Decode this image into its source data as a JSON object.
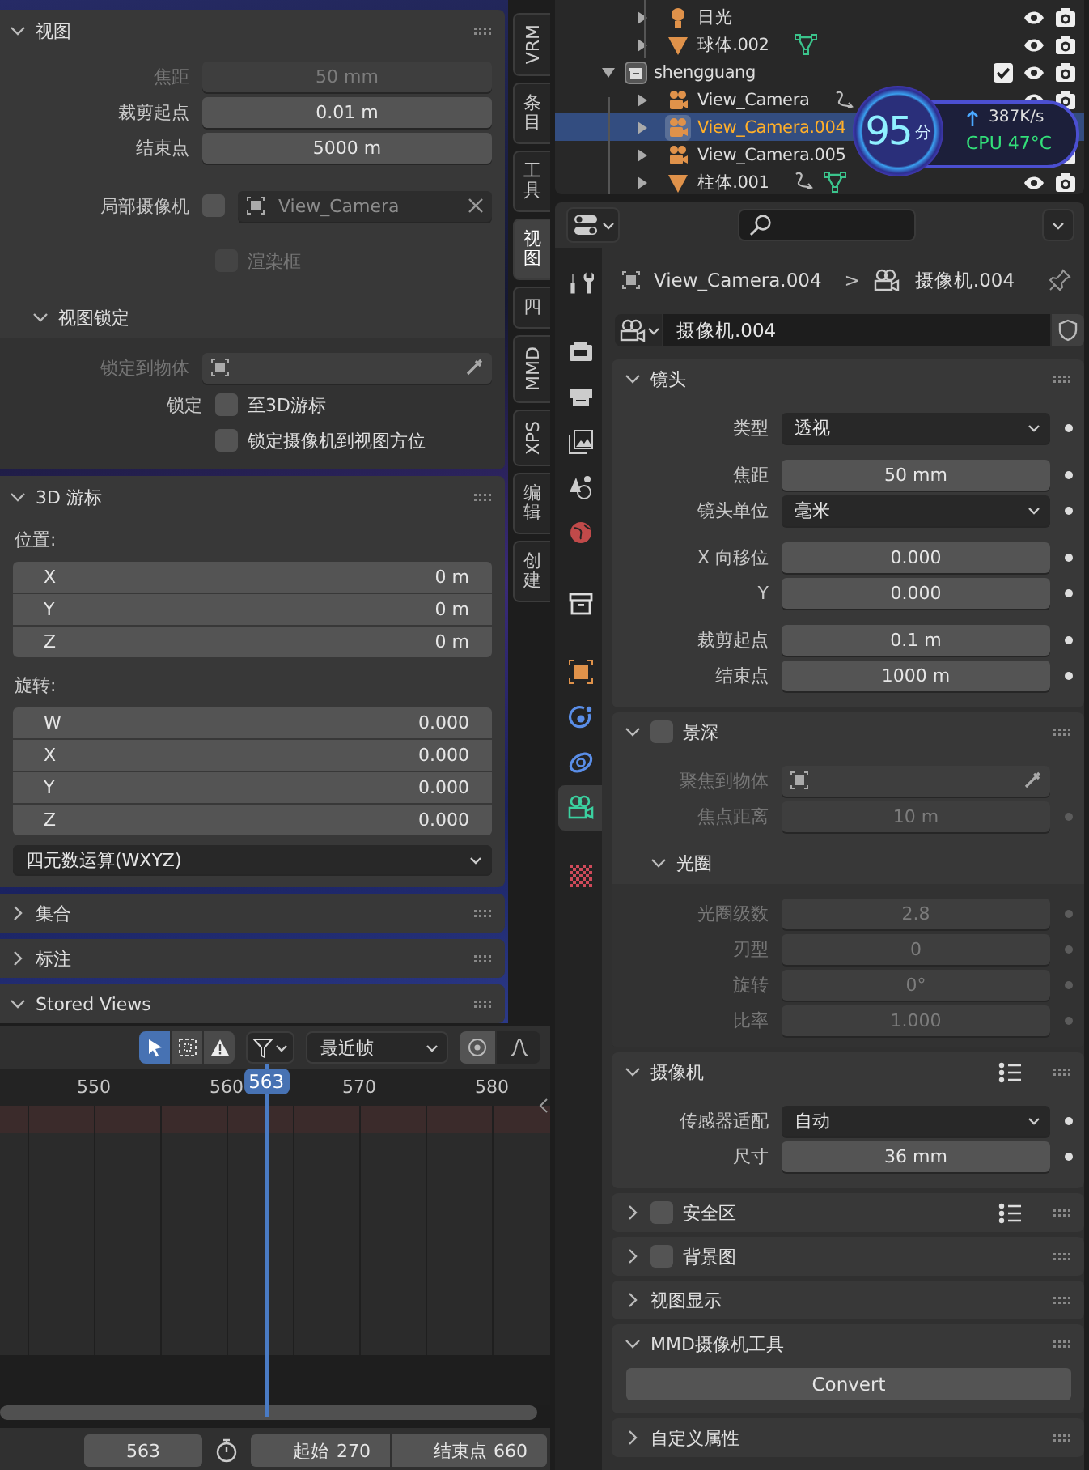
{
  "npanel": {
    "view_panel": {
      "title": "视图",
      "expanded": true,
      "fields": [
        {
          "label": "焦距",
          "value": "50 mm",
          "disabled": true
        },
        {
          "label": "裁剪起点",
          "value": "0.01 m",
          "disabled": false
        },
        {
          "label": "结束点",
          "value": "5000 m",
          "disabled": false
        }
      ],
      "local_camera": {
        "label": "局部摄像机",
        "checked": false,
        "value": "View_Camera"
      },
      "render_region": {
        "label": "渲染框",
        "checked": false,
        "disabled": true
      },
      "view_lock": {
        "title": "视图锁定",
        "expanded": true,
        "lock_object": {
          "label": "锁定到物体",
          "disabled": true
        },
        "lock_label": "锁定",
        "options": [
          {
            "label": "至3D游标",
            "checked": false
          },
          {
            "label": "锁定摄像机到视图方位",
            "checked": false
          }
        ]
      }
    },
    "cursor_panel": {
      "title": "3D 游标",
      "expanded": true,
      "location_label": "位置:",
      "location": [
        {
          "axis": "X",
          "value": "0 m"
        },
        {
          "axis": "Y",
          "value": "0 m"
        },
        {
          "axis": "Z",
          "value": "0 m"
        }
      ],
      "rotation_label": "旋转:",
      "rotation": [
        {
          "axis": "W",
          "value": "0.000"
        },
        {
          "axis": "X",
          "value": "0.000"
        },
        {
          "axis": "Y",
          "value": "0.000"
        },
        {
          "axis": "Z",
          "value": "0.000"
        }
      ],
      "rotation_mode": "四元数运算(WXYZ)"
    },
    "other_panels": [
      {
        "title": "集合",
        "expanded": false
      },
      {
        "title": "标注",
        "expanded": false
      },
      {
        "title": "Stored Views",
        "expanded": true
      }
    ],
    "tabs": [
      {
        "label": "VRM",
        "selected": false
      },
      {
        "label": "条目",
        "selected": false
      },
      {
        "label": "工具",
        "selected": false
      },
      {
        "label": "视图",
        "selected": true
      },
      {
        "label": "四",
        "selected": false
      },
      {
        "label": "MMD",
        "selected": false
      },
      {
        "label": "XPS",
        "selected": false
      },
      {
        "label": "编辑",
        "selected": false
      },
      {
        "label": "创建",
        "selected": false
      }
    ]
  },
  "timeline": {
    "tools": [
      {
        "kind": "select",
        "selected": true
      },
      {
        "kind": "box_select",
        "selected": false
      },
      {
        "kind": "warning",
        "selected": false
      }
    ],
    "snap": "最近帧",
    "ticks": [
      "550",
      "560",
      "570",
      "580"
    ],
    "current_frame": "563",
    "frame_field": "563",
    "start": {
      "label": "起始",
      "value": "270"
    },
    "end": {
      "label": "结束点",
      "value": "660"
    }
  },
  "outliner": {
    "rows_above": [
      {
        "name": "日光",
        "kind": "light",
        "selected": false,
        "has_constraint": false
      },
      {
        "name": "球体.002",
        "kind": "mesh",
        "selected": false,
        "has_constraint": false
      }
    ],
    "collections": [
      {
        "name": "shengguang",
        "expanded": true,
        "checked": true,
        "children": [
          {
            "name": "View_Camera",
            "kind": "camera",
            "selected": false,
            "has_constraint": true
          },
          {
            "name": "View_Camera.004",
            "kind": "camera",
            "selected": true,
            "has_constraint": false
          },
          {
            "name": "View_Camera.005",
            "kind": "camera",
            "selected": false,
            "has_constraint": false
          },
          {
            "name": "柱体.001",
            "kind": "mesh",
            "selected": false,
            "has_constraint": true
          }
        ]
      }
    ]
  },
  "monitor": {
    "score": "95",
    "score_unit": "分",
    "net_speed": "387K/s",
    "cpu": "CPU 47°C"
  },
  "properties": {
    "tabs": [
      {
        "kind": "tool",
        "selected": false
      },
      {
        "kind": "render",
        "selected": false
      },
      {
        "kind": "output",
        "selected": false
      },
      {
        "kind": "view_layer",
        "selected": false
      },
      {
        "kind": "scene",
        "selected": false
      },
      {
        "kind": "world",
        "selected": false
      },
      {
        "kind": "collection",
        "selected": false
      },
      {
        "kind": "object",
        "selected": false
      },
      {
        "kind": "physics",
        "selected": false
      },
      {
        "kind": "constraints",
        "selected": false
      },
      {
        "kind": "data",
        "selected": true
      },
      {
        "kind": "texture",
        "selected": false
      }
    ],
    "breadcrumb": {
      "object": "View_Camera.004",
      "separator": ">",
      "data": "摄像机.004"
    },
    "datablock": "摄像机.004",
    "panels": [
      {
        "title": "镜头",
        "expanded": true,
        "groups": [
          [
            {
              "kind": "menu",
              "label": "类型",
              "value": "透视",
              "disabled": false
            }
          ],
          [
            {
              "kind": "number",
              "label": "焦距",
              "value": "50 mm",
              "disabled": false
            },
            {
              "kind": "menu",
              "label": "镜头单位",
              "value": "毫米",
              "disabled": false
            }
          ],
          [
            {
              "kind": "number",
              "label": "X 向移位",
              "value": "0.000",
              "disabled": false
            },
            {
              "kind": "number",
              "label": "Y",
              "value": "0.000",
              "disabled": false
            }
          ],
          [
            {
              "kind": "number",
              "label": "裁剪起点",
              "value": "0.1 m",
              "disabled": false
            },
            {
              "kind": "number",
              "label": "结束点",
              "value": "1000 m",
              "disabled": false
            }
          ]
        ]
      },
      {
        "title": "景深",
        "expanded": true,
        "checkbox": {
          "checked": false
        },
        "groups": [
          [
            {
              "kind": "object",
              "label": "聚焦到物体",
              "disabled": true
            },
            {
              "kind": "number",
              "label": "焦点距离",
              "value": "10 m",
              "disabled": true
            }
          ]
        ],
        "subpanels": [
          {
            "title": "光圈",
            "expanded": true,
            "groups": [
              [
                {
                  "kind": "number",
                  "label": "光圈级数",
                  "value": "2.8",
                  "disabled": true
                },
                {
                  "kind": "number",
                  "label": "刃型",
                  "value": "0",
                  "disabled": true
                },
                {
                  "kind": "number",
                  "label": "旋转",
                  "value": "0°",
                  "disabled": true
                },
                {
                  "kind": "number",
                  "label": "比率",
                  "value": "1.000",
                  "disabled": true
                }
              ]
            ]
          }
        ]
      },
      {
        "title": "摄像机",
        "expanded": true,
        "presets": true,
        "groups": [
          [
            {
              "kind": "menu",
              "label": "传感器适配",
              "value": "自动",
              "disabled": false
            },
            {
              "kind": "number",
              "label": "尺寸",
              "value": "36 mm",
              "disabled": false
            }
          ]
        ]
      },
      {
        "title": "安全区",
        "expanded": false,
        "checkbox": {
          "checked": false
        },
        "presets": true
      },
      {
        "title": "背景图",
        "expanded": false,
        "checkbox": {
          "checked": false
        }
      },
      {
        "title": "视图显示",
        "expanded": false
      },
      {
        "title": "MMD摄像机工具",
        "expanded": true,
        "button": "Convert"
      },
      {
        "title": "自定义属性",
        "expanded": false
      }
    ]
  }
}
